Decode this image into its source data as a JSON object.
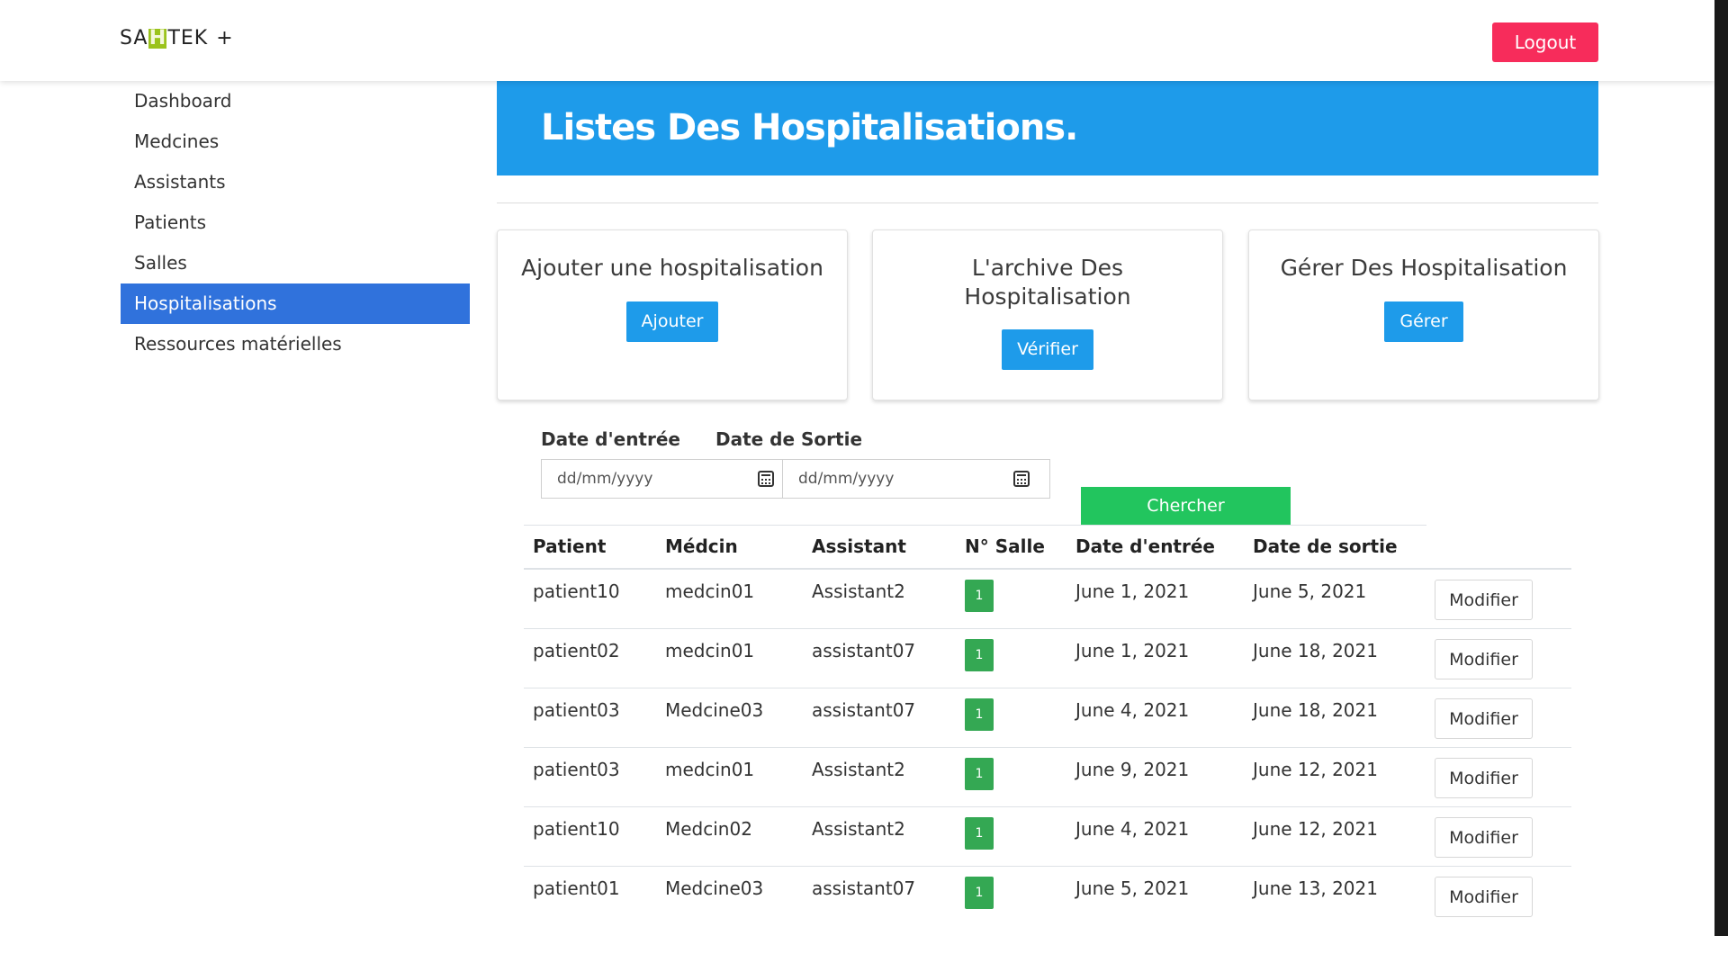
{
  "header": {
    "brand_pre": "SA",
    "brand_h": "H",
    "brand_post": "TEK",
    "brand_plus": "+",
    "logout_label": "Logout"
  },
  "sidebar": {
    "items": [
      {
        "label": "Dashboard"
      },
      {
        "label": "Medcines"
      },
      {
        "label": "Assistants"
      },
      {
        "label": "Patients"
      },
      {
        "label": "Salles"
      },
      {
        "label": "Hospitalisations",
        "active": true
      },
      {
        "label": "Ressources matérielles"
      }
    ]
  },
  "banner": {
    "title": "Listes Des Hospitalisations."
  },
  "cards": [
    {
      "title": "Ajouter une hospitalisation",
      "button": "Ajouter"
    },
    {
      "title": "L'archive Des Hospitalisation",
      "button": "Vérifier"
    },
    {
      "title": "Gérer Des Hospitalisation",
      "button": "Gérer"
    }
  ],
  "filters": {
    "entry_label": "Date d'entrée",
    "exit_label": "Date de Sortie",
    "entry_placeholder": "dd/mm/yyyy",
    "exit_placeholder": "dd/mm/yyyy",
    "search_label": "Chercher"
  },
  "table": {
    "columns": [
      "Patient",
      "Médcin",
      "Assistant",
      "N° Salle",
      "Date d'entrée",
      "Date de sortie"
    ],
    "rows": [
      {
        "patient": "patient10",
        "medcin": "medcin01",
        "assistant": "Assistant2",
        "salle": "1",
        "entree": "June 1, 2021",
        "sortie": "June 5, 2021",
        "action": "Modifier"
      },
      {
        "patient": "patient02",
        "medcin": "medcin01",
        "assistant": "assistant07",
        "salle": "1",
        "entree": "June 1, 2021",
        "sortie": "June 18, 2021",
        "action": "Modifier"
      },
      {
        "patient": "patient03",
        "medcin": "Medcine03",
        "assistant": "assistant07",
        "salle": "1",
        "entree": "June 4, 2021",
        "sortie": "June 18, 2021",
        "action": "Modifier"
      },
      {
        "patient": "patient03",
        "medcin": "medcin01",
        "assistant": "Assistant2",
        "salle": "1",
        "entree": "June 9, 2021",
        "sortie": "June 12, 2021",
        "action": "Modifier"
      },
      {
        "patient": "patient10",
        "medcin": "Medcin02",
        "assistant": "Assistant2",
        "salle": "1",
        "entree": "June 4, 2021",
        "sortie": "June 12, 2021",
        "action": "Modifier"
      },
      {
        "patient": "patient01",
        "medcin": "Medcine03",
        "assistant": "assistant07",
        "salle": "1",
        "entree": "June 5, 2021",
        "sortie": "June 13, 2021",
        "action": "Modifier"
      }
    ]
  },
  "colors": {
    "primary": "#1e9bea",
    "sidebar_active": "#3072dc",
    "logout": "#f72c5b",
    "search": "#22c55e",
    "badge": "#34a853",
    "brand_h": "#9bc31c"
  }
}
